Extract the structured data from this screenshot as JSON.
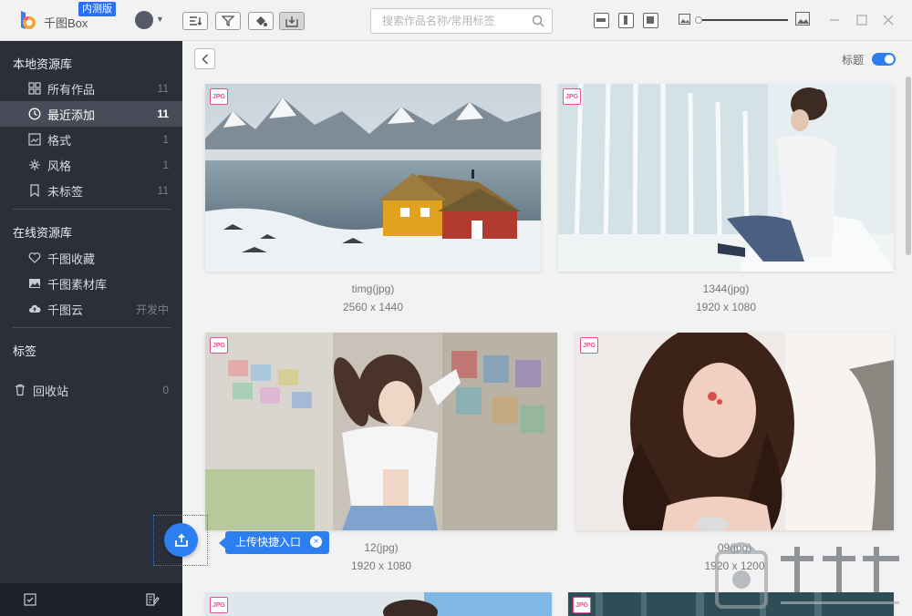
{
  "app": {
    "name": "千图Box",
    "beta_badge": "内测版"
  },
  "search": {
    "placeholder": "搜索作品名称/常用标签"
  },
  "sidebar": {
    "local_title": "本地资源库",
    "local_items": [
      {
        "label": "所有作品",
        "count": "11"
      },
      {
        "label": "最近添加",
        "count": "11"
      },
      {
        "label": "格式",
        "count": "1"
      },
      {
        "label": "风格",
        "count": "1"
      },
      {
        "label": "未标签",
        "count": "11"
      }
    ],
    "online_title": "在线资源库",
    "online_items": [
      {
        "label": "千图收藏",
        "count": ""
      },
      {
        "label": "千图素材库",
        "count": ""
      },
      {
        "label": "千图云",
        "count": "开发中"
      }
    ],
    "tags_title": "标签",
    "trash": {
      "label": "回收站",
      "count": "0"
    }
  },
  "main": {
    "title_toggle_label": "标题",
    "title_toggle_on": true
  },
  "cards": [
    {
      "badge": "JPG",
      "name": "timg(jpg)",
      "size": "2560 x 1440"
    },
    {
      "badge": "JPG",
      "name": "1344(jpg)",
      "size": "1920 x 1080"
    },
    {
      "badge": "JPG",
      "name": "12(jpg)",
      "size": "1920 x 1080"
    },
    {
      "badge": "JPG",
      "name": "09(jpg)",
      "size": "1920 x 1200"
    },
    {
      "badge": "JPG"
    },
    {
      "badge": "JPG"
    }
  ],
  "upload_tip": {
    "label": "上传快捷入口",
    "close": "×"
  },
  "colors": {
    "accent": "#2d7ff0",
    "sidebar_bg": "#2a2f3a",
    "badge_pink": "#e84f8e"
  },
  "icons": [
    "logo-icon",
    "avatar-icon",
    "sort-icon",
    "filter-icon",
    "paint-bucket-icon",
    "import-icon",
    "search-icon",
    "layout-1-icon",
    "layout-2-icon",
    "layout-3-icon",
    "image-small-icon",
    "image-large-icon",
    "minimize-icon",
    "maximize-icon",
    "close-icon",
    "grid-icon",
    "clock-icon",
    "format-icon",
    "style-icon",
    "bookmark-icon",
    "heart-icon",
    "picture-icon",
    "cloud-icon",
    "trash-icon",
    "back-icon",
    "upload-icon"
  ]
}
